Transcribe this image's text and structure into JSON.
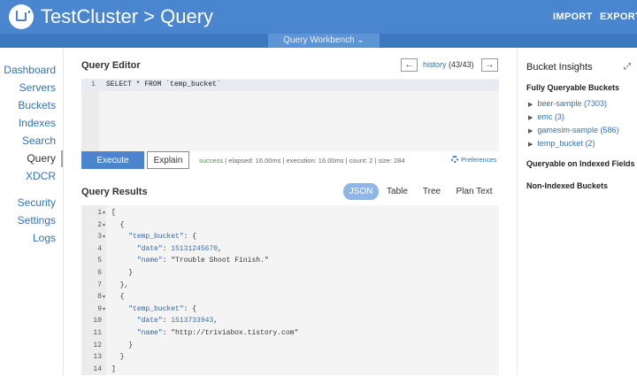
{
  "header": {
    "title": "TestCluster > Query",
    "import_label": "IMPORT",
    "export_label": "EXPORT",
    "workbench_label": "Query Workbench ⌄"
  },
  "sidebar": {
    "items": [
      {
        "label": "Dashboard"
      },
      {
        "label": "Servers"
      },
      {
        "label": "Buckets"
      },
      {
        "label": "Indexes"
      },
      {
        "label": "Search"
      },
      {
        "label": "Query"
      },
      {
        "label": "XDCR"
      },
      {
        "label": "Security"
      },
      {
        "label": "Settings"
      },
      {
        "label": "Logs"
      }
    ]
  },
  "editor": {
    "title": "Query Editor",
    "history_prev": "←",
    "history_next": "→",
    "history_link": "history",
    "history_count": "(43/43)",
    "line_number": "1",
    "query": "SELECT * FROM `temp_bucket`",
    "execute_label": "Execute",
    "explain_label": "Explain",
    "status_ok": "success",
    "status_rest": " | elapsed: 16.00ms | execution: 16.00ms | count: 2 | size: 284",
    "preferences_label": "Preferences"
  },
  "results": {
    "title": "Query Results",
    "formats": [
      "JSON",
      "Table",
      "Tree",
      "Plan Text"
    ],
    "selected_format": "JSON",
    "lines": [
      {
        "n": "1",
        "fold": true,
        "t": "[",
        "k": "",
        "v": "",
        "vt": ""
      },
      {
        "n": "2",
        "fold": true,
        "t": "  {",
        "k": "",
        "v": "",
        "vt": ""
      },
      {
        "n": "3",
        "fold": true,
        "t": "    ",
        "k": "\"temp_bucket\"",
        "v": ": {",
        "vt": "s"
      },
      {
        "n": "4",
        "fold": false,
        "t": "      ",
        "k": "\"date\"",
        "v": "15131245670",
        "vt": "n"
      },
      {
        "n": "5",
        "fold": false,
        "t": "      ",
        "k": "\"name\"",
        "v": "\"Trouble Shoot Finish.\"",
        "vt": "s"
      },
      {
        "n": "6",
        "fold": false,
        "t": "    }",
        "k": "",
        "v": "",
        "vt": ""
      },
      {
        "n": "7",
        "fold": false,
        "t": "  },",
        "k": "",
        "v": "",
        "vt": ""
      },
      {
        "n": "8",
        "fold": true,
        "t": "  {",
        "k": "",
        "v": "",
        "vt": ""
      },
      {
        "n": "9",
        "fold": true,
        "t": "    ",
        "k": "\"temp_bucket\"",
        "v": ": {",
        "vt": "s"
      },
      {
        "n": "10",
        "fold": false,
        "t": "      ",
        "k": "\"date\"",
        "v": "1513733943",
        "vt": "n"
      },
      {
        "n": "11",
        "fold": false,
        "t": "      ",
        "k": "\"name\"",
        "v": "\"http://triviabox.tistory.com\"",
        "vt": "s"
      },
      {
        "n": "12",
        "fold": false,
        "t": "    }",
        "k": "",
        "v": "",
        "vt": ""
      },
      {
        "n": "13",
        "fold": false,
        "t": "  }",
        "k": "",
        "v": "",
        "vt": ""
      },
      {
        "n": "14",
        "fold": false,
        "t": "]",
        "k": "",
        "v": "",
        "vt": ""
      }
    ]
  },
  "insights": {
    "title": "Bucket Insights",
    "fully_queryable_label": "Fully Queryable Buckets",
    "buckets": [
      {
        "name": "beer-sample",
        "count": "(7303)"
      },
      {
        "name": "emc",
        "count": "(3)"
      },
      {
        "name": "gamesim-sample",
        "count": "(586)"
      },
      {
        "name": "temp_bucket",
        "count": "(2)"
      }
    ],
    "indexed_label": "Queryable on Indexed Fields",
    "non_indexed_label": "Non-Indexed Buckets"
  },
  "colors": {
    "header_bg": "#4a86d0",
    "link": "#2f72c4",
    "success": "#3a9a3a"
  }
}
